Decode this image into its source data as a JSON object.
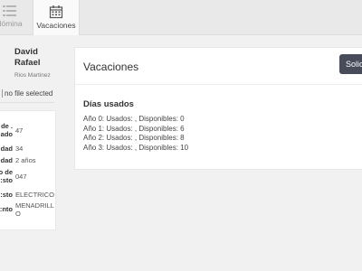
{
  "tabs": [
    {
      "label": "Nómina",
      "icon": "list-icon",
      "active": false
    },
    {
      "label": "Vacaciones",
      "icon": "calendar-icon",
      "active": true
    }
  ],
  "profile": {
    "first_names": "David Rafael",
    "surname": "Rios Martinez",
    "file_status": "no file selected"
  },
  "info": [
    {
      "key": "No. de Empleado:",
      "value": "47"
    },
    {
      "key": "Edad:",
      "value": "34"
    },
    {
      "key": "Antigüedad:",
      "value": "2 años"
    },
    {
      "key": "Centro de Costo:",
      "value": "047"
    },
    {
      "key": "Puesto:",
      "value": "ELECTRICO"
    },
    {
      "key": "Departamento:",
      "value": "MENADRILLO"
    }
  ],
  "main": {
    "title": "Vacaciones",
    "request_button": "Solicitar",
    "section_title": "Días usados",
    "years": [
      "Año 0: Usados: , Disponibles: 0",
      "Año 1: Usados: , Disponibles: 6",
      "Año 2: Usados: , Disponibles: 8",
      "Año 3: Usados: , Disponibles: 10"
    ]
  },
  "colors": {
    "background": "#f1f1f2",
    "button": "#474b5a",
    "card": "#ffffff"
  }
}
